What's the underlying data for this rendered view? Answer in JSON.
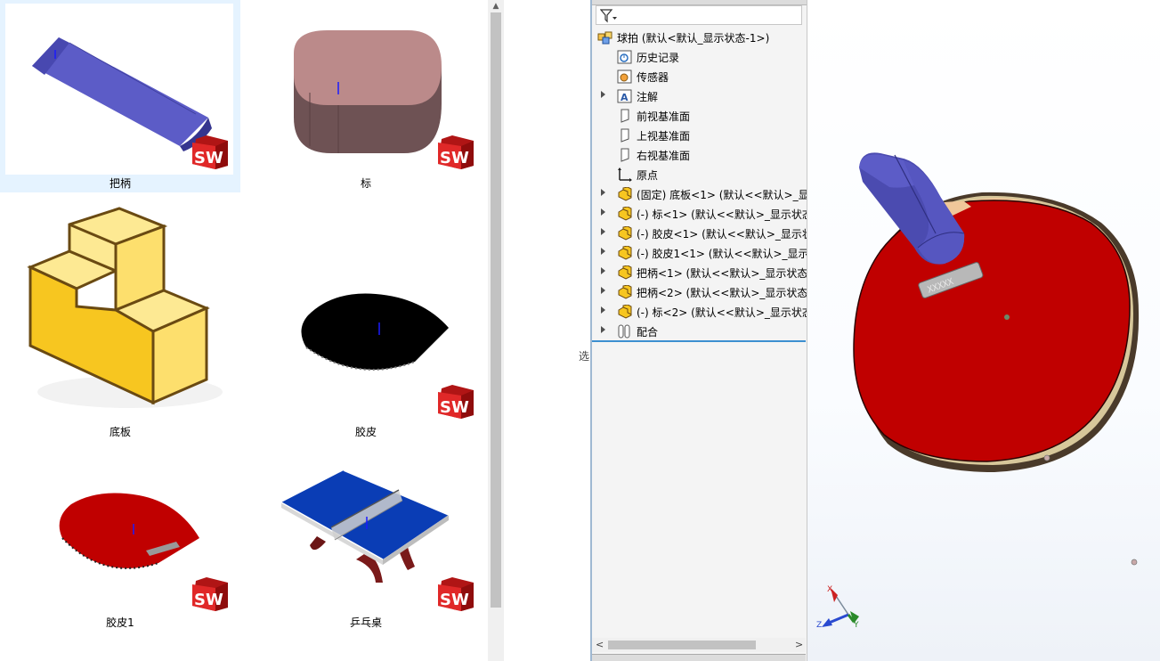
{
  "explorer": {
    "files": [
      {
        "name": "把柄",
        "selected": true
      },
      {
        "name": "标"
      },
      {
        "name": "底板"
      },
      {
        "name": "胶皮"
      },
      {
        "name": "胶皮1"
      },
      {
        "name": "乒乓桌"
      }
    ],
    "badge_text": "SW"
  },
  "gap_text": "选",
  "feature_tree": {
    "root": "球拍  (默认<默认_显示状态-1>)",
    "items": [
      {
        "label": "历史记录",
        "icon": "history-icon",
        "expandable": false
      },
      {
        "label": "传感器",
        "icon": "sensor-icon",
        "expandable": false
      },
      {
        "label": "注解",
        "icon": "annotation-icon",
        "expandable": true
      },
      {
        "label": "前视基准面",
        "icon": "plane-icon",
        "expandable": false
      },
      {
        "label": "上视基准面",
        "icon": "plane-icon",
        "expandable": false
      },
      {
        "label": "右视基准面",
        "icon": "plane-icon",
        "expandable": false
      },
      {
        "label": "原点",
        "icon": "origin-icon",
        "expandable": false
      },
      {
        "label": "(固定) 底板<1> (默认<<默认>_显示",
        "icon": "part-icon",
        "expandable": true
      },
      {
        "label": "(-) 标<1> (默认<<默认>_显示状态",
        "icon": "part-icon",
        "expandable": true
      },
      {
        "label": "(-) 胶皮<1> (默认<<默认>_显示状",
        "icon": "part-icon",
        "expandable": true
      },
      {
        "label": "(-) 胶皮1<1> (默认<<默认>_显示状",
        "icon": "part-icon",
        "expandable": true
      },
      {
        "label": "把柄<1> (默认<<默认>_显示状态",
        "icon": "part-icon",
        "expandable": true
      },
      {
        "label": "把柄<2> (默认<<默认>_显示状态",
        "icon": "part-icon",
        "expandable": true
      },
      {
        "label": "(-) 标<2> (默认<<默认>_显示状态",
        "icon": "part-icon",
        "expandable": true
      },
      {
        "label": "配合",
        "icon": "mates-icon",
        "expandable": true
      }
    ]
  },
  "viewport": {
    "triad_labels": {
      "x": "X",
      "y": "Y",
      "z": "Z"
    },
    "logo_text": "XXXXX"
  },
  "colors": {
    "handle_blue": "#5c5cc7",
    "rubber_red": "#c00000",
    "wood": "#f0c79a",
    "base_yellow": "#fcd84a",
    "table_blue": "#0a3db5",
    "sw_red": "#d52020",
    "selection": "#e5f3ff",
    "tree_divider": "#3c8fd0"
  }
}
